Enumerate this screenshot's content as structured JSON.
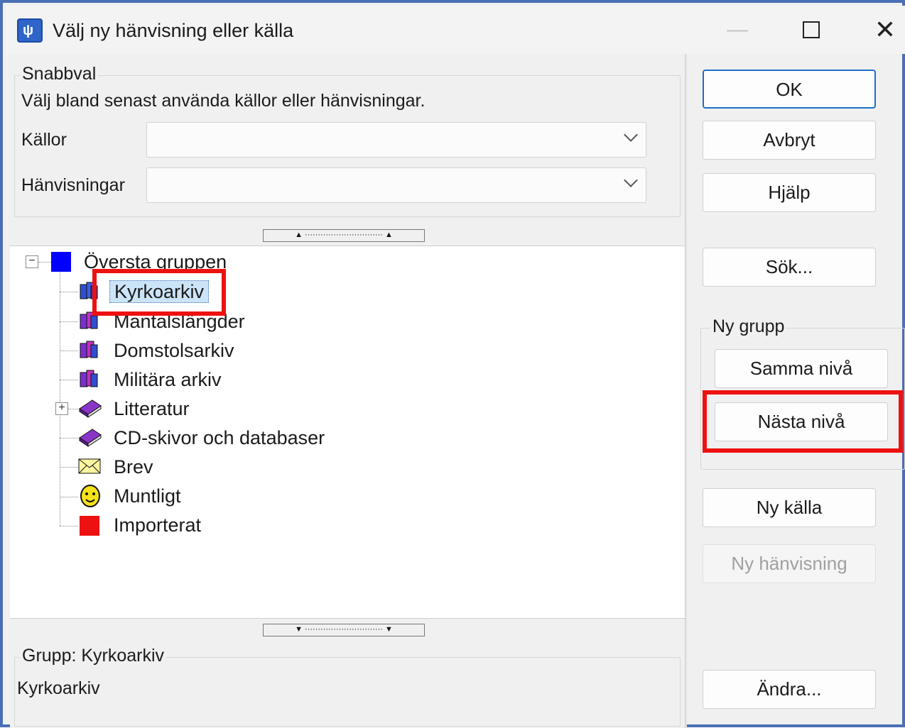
{
  "window": {
    "title": "Välj ny hänvisning eller källa",
    "min_glyph": "—",
    "close_glyph": "✕"
  },
  "quick": {
    "legend": "Snabbval",
    "description": "Välj bland senast använda källor eller hänvisningar.",
    "sources_label": "Källor",
    "refs_label": "Hänvisningar",
    "sources_value": "",
    "refs_value": ""
  },
  "splitters": {
    "top": "▲ ······························ ▲",
    "bottom": "▼ ······························ ▼"
  },
  "tree": {
    "root": "Översta gruppen",
    "items": [
      {
        "label": "Kyrkoarkiv",
        "icon": "books-blue-icon"
      },
      {
        "label": "Mantalslängder",
        "icon": "books-purple-icon"
      },
      {
        "label": "Domstolsarkiv",
        "icon": "books-purple-icon"
      },
      {
        "label": "Militära arkiv",
        "icon": "books-purple-icon"
      },
      {
        "label": "Litteratur",
        "icon": "book-purple-icon"
      },
      {
        "label": "CD-skivor och databaser",
        "icon": "book-purple-icon"
      },
      {
        "label": "Brev",
        "icon": "envelope-icon"
      },
      {
        "label": "Muntligt",
        "icon": "face-icon"
      },
      {
        "label": "Importerat",
        "icon": "red-square-icon"
      }
    ],
    "expander_minus": "−",
    "expander_plus": "+"
  },
  "group_info": {
    "legend": "Grupp: Kyrkoarkiv",
    "value": "Kyrkoarkiv"
  },
  "buttons": {
    "ok": "OK",
    "cancel": "Avbryt",
    "help": "Hjälp",
    "search": "Sök...",
    "new_group_legend": "Ny grupp",
    "same_level": "Samma nivå",
    "next_level": "Nästa nivå",
    "new_source": "Ny källa",
    "new_reference": "Ny hänvisning",
    "edit": "Ändra..."
  },
  "colors": {
    "accent": "#1f6fc5",
    "highlight": "#ee1111",
    "frame": "#4a6fb5"
  }
}
